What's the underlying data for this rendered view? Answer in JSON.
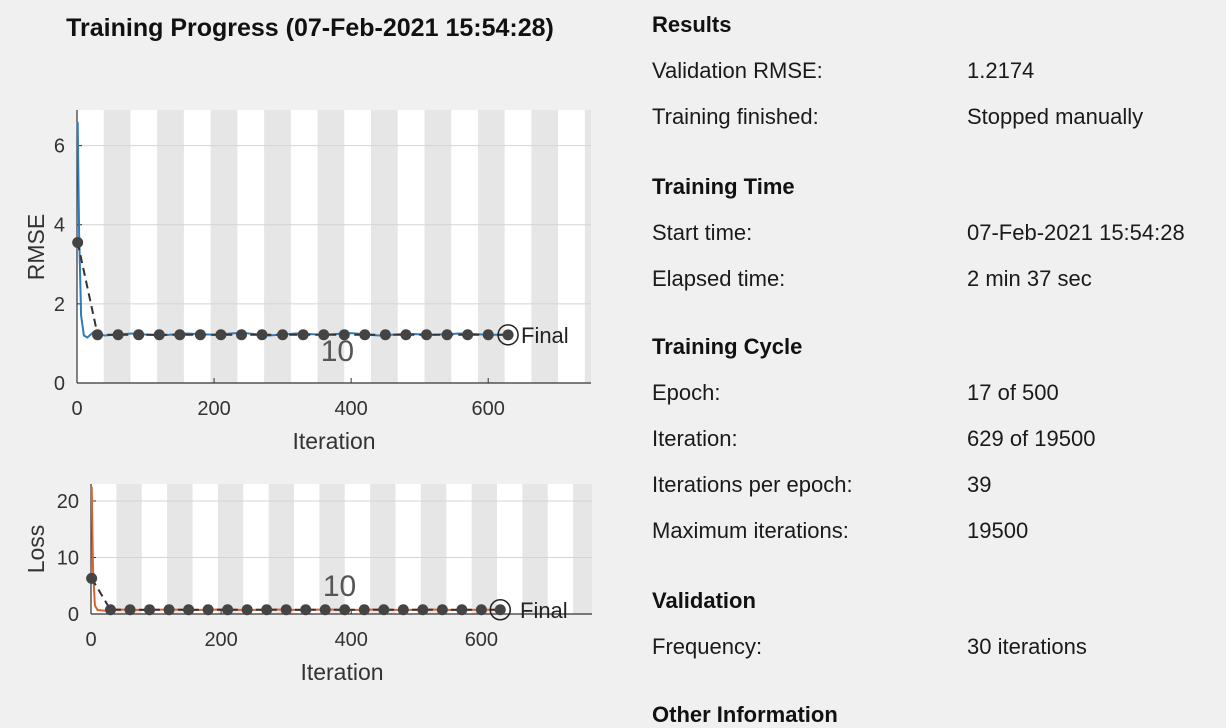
{
  "title": "Training Progress (07-Feb-2021 15:54:28)",
  "plots": {
    "rmse": {
      "ylabel": "RMSE",
      "xlabel": "Iteration",
      "annotation": "10",
      "final_label": "Final",
      "line_color": "#2f7bbf"
    },
    "loss": {
      "ylabel": "Loss",
      "xlabel": "Iteration",
      "annotation": "10",
      "final_label": "Final",
      "line_color": "#d9622b"
    }
  },
  "chart_data": [
    {
      "type": "line",
      "xlabel": "Iteration",
      "ylabel": "RMSE",
      "xlim": [
        0,
        750
      ],
      "ylim": [
        0,
        6.9
      ],
      "x_ticks": [
        0,
        200,
        400,
        600
      ],
      "y_ticks": [
        0,
        2,
        4,
        6
      ],
      "epoch_length": 39,
      "series": [
        {
          "x": [
            1,
            3,
            6,
            10,
            15,
            25,
            40,
            80,
            120,
            160,
            200,
            240,
            280,
            320,
            360,
            400,
            440,
            480,
            520,
            560,
            600,
            629
          ],
          "y": [
            6.6,
            3.8,
            1.7,
            1.2,
            1.15,
            1.3,
            1.2,
            1.25,
            1.2,
            1.25,
            1.22,
            1.27,
            1.2,
            1.25,
            1.22,
            1.26,
            1.2,
            1.24,
            1.22,
            1.25,
            1.22,
            1.22
          ]
        },
        {
          "x": [
            1,
            30,
            60,
            90,
            120,
            150,
            180,
            210,
            240,
            270,
            300,
            330,
            360,
            390,
            420,
            450,
            480,
            510,
            540,
            570,
            600,
            629
          ],
          "y": [
            3.55,
            1.22,
            1.22,
            1.22,
            1.22,
            1.22,
            1.22,
            1.22,
            1.22,
            1.22,
            1.22,
            1.22,
            1.22,
            1.22,
            1.22,
            1.22,
            1.22,
            1.22,
            1.22,
            1.22,
            1.22,
            1.2174
          ]
        }
      ],
      "annotations": [
        {
          "x": 380,
          "y": 0.55,
          "text": "10"
        }
      ]
    },
    {
      "type": "line",
      "xlabel": "Iteration",
      "ylabel": "Loss",
      "xlim": [
        0,
        770
      ],
      "ylim": [
        0,
        23
      ],
      "x_ticks": [
        0,
        200,
        400,
        600
      ],
      "y_ticks": [
        0,
        10,
        20
      ],
      "epoch_length": 39,
      "series": [
        {
          "x": [
            1,
            3,
            6,
            10,
            20,
            40,
            80,
            120,
            160,
            200,
            240,
            280,
            320,
            360,
            400,
            440,
            480,
            520,
            560,
            600,
            629
          ],
          "y": [
            22.5,
            8,
            1.5,
            0.7,
            0.6,
            0.8,
            0.7,
            0.8,
            0.7,
            0.8,
            0.7,
            0.8,
            0.7,
            0.8,
            0.7,
            0.8,
            0.7,
            0.8,
            0.7,
            0.75,
            0.75
          ]
        },
        {
          "x": [
            1,
            30,
            60,
            90,
            120,
            150,
            180,
            210,
            240,
            270,
            300,
            330,
            360,
            390,
            420,
            450,
            480,
            510,
            540,
            570,
            600,
            629
          ],
          "y": [
            6.3,
            0.75,
            0.75,
            0.75,
            0.75,
            0.75,
            0.75,
            0.75,
            0.75,
            0.75,
            0.75,
            0.75,
            0.75,
            0.75,
            0.75,
            0.75,
            0.75,
            0.75,
            0.75,
            0.75,
            0.75,
            0.75
          ]
        }
      ],
      "annotations": [
        {
          "x": 382,
          "y": 3.2,
          "text": "10"
        }
      ]
    }
  ],
  "info": {
    "results": {
      "heading": "Results",
      "validation_rmse_label": "Validation RMSE:",
      "validation_rmse_value": "1.2174",
      "training_finished_label": "Training finished:",
      "training_finished_value": "Stopped manually"
    },
    "training_time": {
      "heading": "Training Time",
      "start_time_label": "Start time:",
      "start_time_value": "07-Feb-2021 15:54:28",
      "elapsed_time_label": "Elapsed time:",
      "elapsed_time_value": "2 min 37 sec"
    },
    "training_cycle": {
      "heading": "Training Cycle",
      "epoch_label": "Epoch:",
      "epoch_value": "17 of 500",
      "iteration_label": "Iteration:",
      "iteration_value": "629 of 19500",
      "iterations_per_epoch_label": "Iterations per epoch:",
      "iterations_per_epoch_value": "39",
      "max_iterations_label": "Maximum iterations:",
      "max_iterations_value": "19500"
    },
    "validation": {
      "heading": "Validation",
      "frequency_label": "Frequency:",
      "frequency_value": "30 iterations"
    },
    "other": {
      "heading": "Other Information"
    }
  }
}
